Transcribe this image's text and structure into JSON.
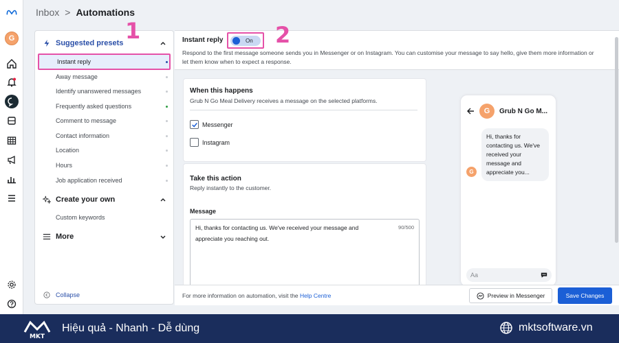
{
  "breadcrumb": {
    "root": "Inbox",
    "sep": ">",
    "current": "Automations"
  },
  "rail": {
    "avatar_letter": "G"
  },
  "sidebar": {
    "suggested": "Suggested presets",
    "items": [
      {
        "label": "Instant reply",
        "active": true
      },
      {
        "label": "Away message"
      },
      {
        "label": "Identify unanswered messages"
      },
      {
        "label": "Frequently asked questions",
        "status": "green"
      },
      {
        "label": "Comment to message"
      },
      {
        "label": "Contact information"
      },
      {
        "label": "Location"
      },
      {
        "label": "Hours"
      },
      {
        "label": "Job application received"
      }
    ],
    "create_own": "Create your own",
    "custom_keywords": "Custom keywords",
    "more": "More",
    "collapse": "Collapse"
  },
  "main": {
    "title": "Instant reply",
    "toggle_label": "On",
    "description": "Respond to the first message someone sends you in Messenger or on Instagram. You can customise your message to say hello, give them more information or let them know when to expect a response.",
    "when": {
      "title": "When this happens",
      "subtitle": "Grub N Go Meal Delivery receives a message on the selected platforms.",
      "platforms": [
        {
          "label": "Messenger",
          "checked": true
        },
        {
          "label": "Instagram",
          "checked": false
        }
      ]
    },
    "action": {
      "title": "Take this action",
      "subtitle": "Reply instantly to the customer.",
      "message_label": "Message",
      "message_text": "Hi, thanks for contacting us. We've received your message and appreciate you reaching out.",
      "counter": "90/500"
    },
    "preview": {
      "avatar_letter": "G",
      "page_name": "Grub N Go M...",
      "bubble": "Hi, thanks for contacting us. We've received your message and appreciate you...",
      "input_placeholder": "Aa"
    },
    "footer": {
      "info_prefix": "For more information on automation, visit the ",
      "help_link": "Help Centre",
      "preview_button": "Preview in Messenger",
      "save_button": "Save Changes"
    }
  },
  "annotations": {
    "step1": "1",
    "step2": "2"
  },
  "banner": {
    "logo_text": "MKT",
    "slogan": "Hiệu quả - Nhanh - Dễ dùng",
    "website": "mktsoftware.vn"
  },
  "colors": {
    "accent": "#1b5fd6",
    "annotation": "#e551a8",
    "banner": "#1a2d5c"
  }
}
